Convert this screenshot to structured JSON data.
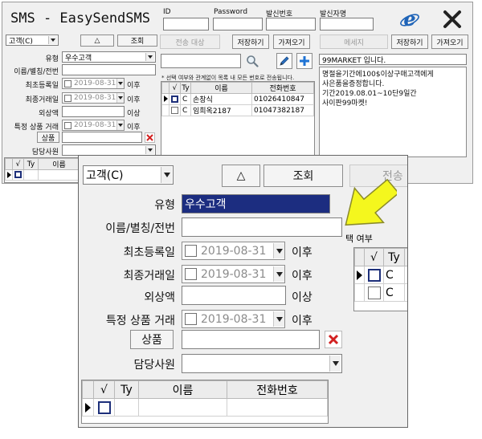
{
  "title": "SMS  -  EasySendSMS",
  "header": {
    "id_label": "ID",
    "password_label": "Password",
    "sender_number_label": "발신번호",
    "sender_name_label": "발신자명"
  },
  "icons": {
    "ie": "internet-explorer-icon",
    "close": "close-icon",
    "search": "magnifier-icon",
    "pen": "pencil-icon",
    "add": "plus-icon",
    "delete": "delete-x-icon"
  },
  "colors": {
    "selection": "#1c2d80",
    "ie_blue": "#1f64b8",
    "delete_red": "#d22020",
    "arrow_fill": "#f4f71e"
  },
  "filter": {
    "category": "고객(C)",
    "sort_label": "△",
    "lookup_label": "조회",
    "type_label": "유형",
    "type_value": "우수고객",
    "name_label": "이름/별칭/전번",
    "first_reg_label": "최초등록일",
    "first_reg_date": "2019-08-31",
    "last_trade_label": "최종거래일",
    "last_trade_date": "2019-08-31",
    "after_label": "이후",
    "credit_label": "외상액",
    "above_label": "이상",
    "product_trade_label": "특정 상품 거래",
    "product_trade_date": "2019-08-31",
    "product_button": "상품",
    "staff_label": "담당사원"
  },
  "customer_grid": {
    "columns": [
      "√",
      "Ty",
      "이름",
      "전화번호"
    ]
  },
  "target": {
    "tab_label": "전송 대상",
    "save_label": "저장하기",
    "load_label": "가져오기",
    "notice": "* 선택 여부와 관계없이 목록 내 모든 번호로 전송됩니다.",
    "columns": [
      "√",
      "Ty",
      "이름",
      "전화번호"
    ],
    "rows": [
      {
        "type": "C",
        "name": "손창식",
        "phone": "01026410847"
      },
      {
        "type": "C",
        "name": "임희옥2187",
        "phone": "01047382187"
      }
    ]
  },
  "message": {
    "tab_label": "메세지",
    "save_label": "저장하기",
    "load_label": "가져오기",
    "subject": "99MARKET 입니다.",
    "body": [
      "명절을기간에100$이상구매고객에게",
      "사은품을증정합니다.",
      "기간2019.08.01~10단9일간",
      "사이판99마켓!"
    ]
  },
  "zoom": {
    "send_partial": "전송",
    "selection_partial": "택 여부"
  }
}
